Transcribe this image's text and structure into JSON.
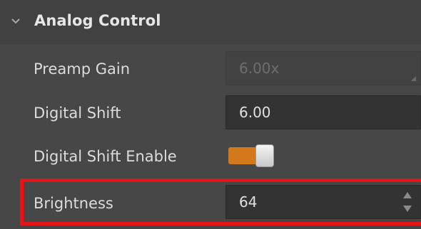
{
  "section": {
    "title": "Analog Control",
    "expanded_icon": "chevron-down-icon"
  },
  "properties": {
    "preamp_gain": {
      "label": "Preamp Gain",
      "value": "6.00x",
      "enabled": false
    },
    "digital_shift": {
      "label": "Digital Shift",
      "value": "6.00"
    },
    "digital_shift_enable": {
      "label": "Digital Shift Enable",
      "state": "on"
    },
    "brightness": {
      "label": "Brightness",
      "value": "64"
    }
  },
  "colors": {
    "toggle_on": "#d4781c",
    "highlight": "#e0161b"
  }
}
